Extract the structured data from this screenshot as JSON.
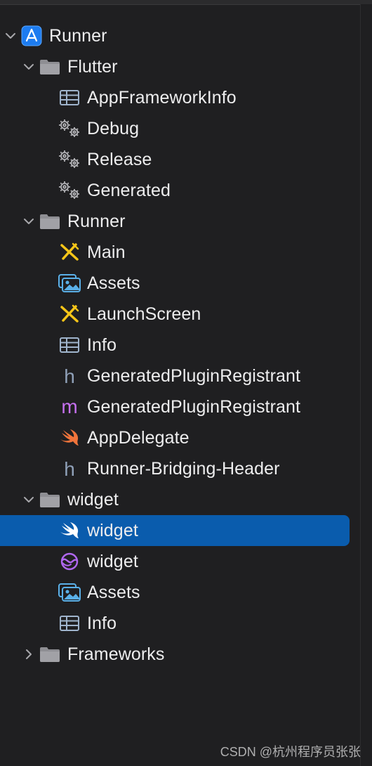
{
  "tree": {
    "items": [
      {
        "label": "Runner",
        "icon": "app-project-icon",
        "chevron": "expanded"
      },
      {
        "label": "Flutter",
        "icon": "folder-icon",
        "chevron": "expanded"
      },
      {
        "label": "AppFrameworkInfo",
        "icon": "plist-icon"
      },
      {
        "label": "Debug",
        "icon": "xcconfig-icon"
      },
      {
        "label": "Release",
        "icon": "xcconfig-icon"
      },
      {
        "label": "Generated",
        "icon": "xcconfig-icon"
      },
      {
        "label": "Runner",
        "icon": "folder-icon",
        "chevron": "expanded"
      },
      {
        "label": "Main",
        "icon": "storyboard-icon"
      },
      {
        "label": "Assets",
        "icon": "asset-catalog-icon"
      },
      {
        "label": "LaunchScreen",
        "icon": "storyboard-icon"
      },
      {
        "label": "Info",
        "icon": "plist-icon"
      },
      {
        "label": "GeneratedPluginRegistrant",
        "icon": "header-file-icon"
      },
      {
        "label": "GeneratedPluginRegistrant",
        "icon": "objc-file-icon"
      },
      {
        "label": "AppDelegate",
        "icon": "swift-file-icon"
      },
      {
        "label": "Runner-Bridging-Header",
        "icon": "header-file-icon"
      },
      {
        "label": "widget",
        "icon": "folder-icon",
        "chevron": "expanded"
      },
      {
        "label": "widget",
        "icon": "swift-file-icon",
        "selected": true
      },
      {
        "label": "widget",
        "icon": "intent-definition-icon"
      },
      {
        "label": "Assets",
        "icon": "asset-catalog-icon"
      },
      {
        "label": "Info",
        "icon": "plist-icon"
      },
      {
        "label": "Frameworks",
        "icon": "folder-icon",
        "chevron": "collapsed"
      }
    ]
  },
  "watermark": "CSDN @杭州程序员张张",
  "colors": {
    "background": "#1f1f21",
    "selection": "#0a5cad",
    "text": "#ededee",
    "folder": "#9a9a9e",
    "swift": "#f0743b",
    "storyboard": "#f5c518",
    "asset": "#5ab0e8",
    "objc": "#c670f0"
  }
}
